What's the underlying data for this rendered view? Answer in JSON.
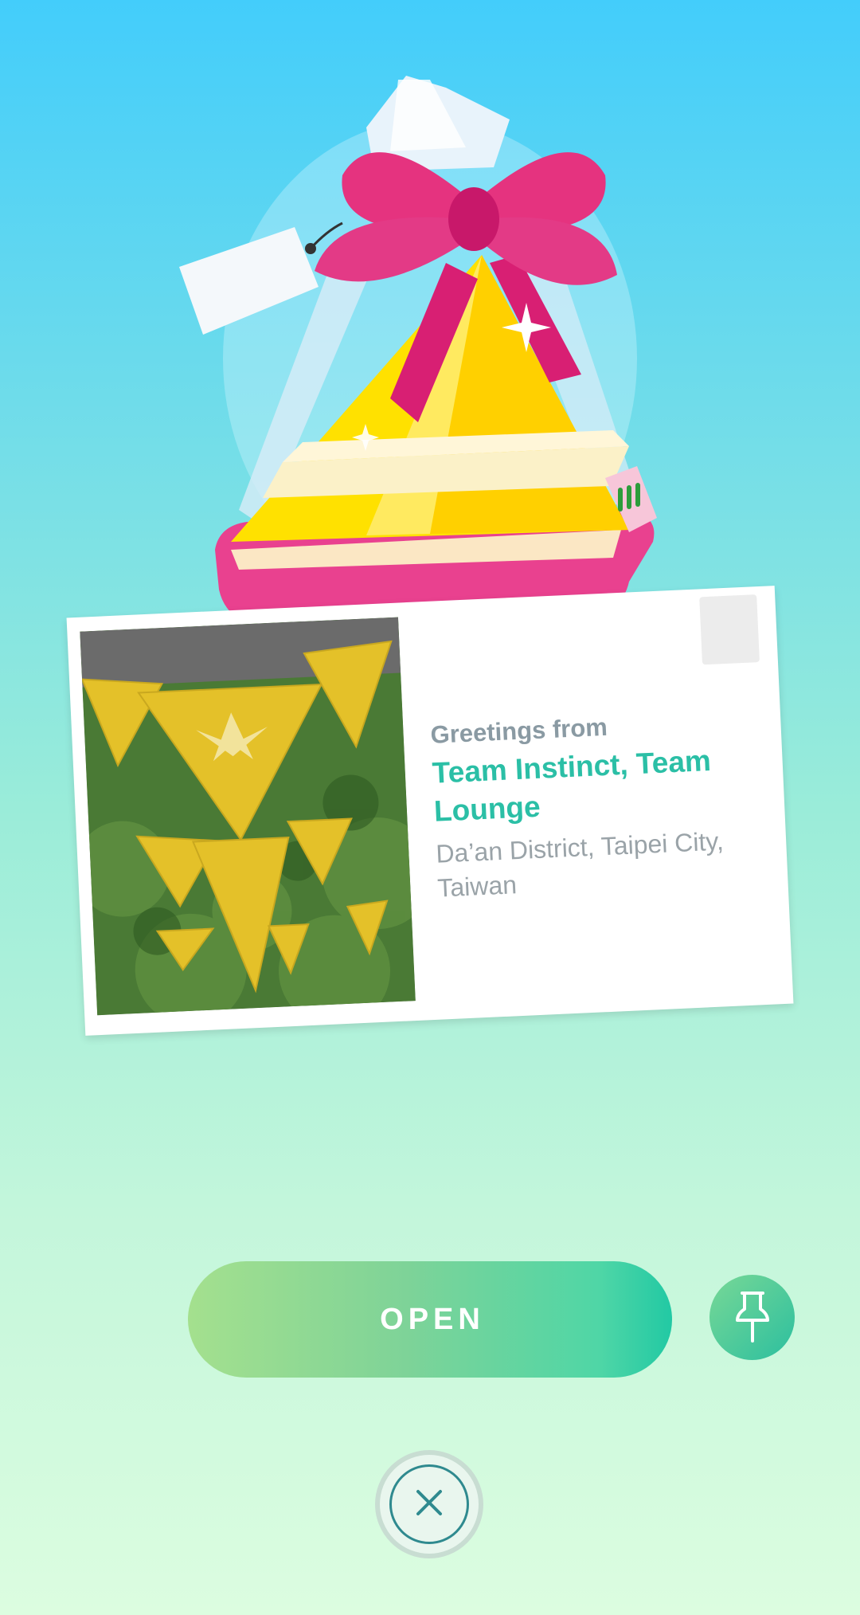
{
  "gift": {
    "image_name": "gift-icon"
  },
  "postcard": {
    "greeting_label": "Greetings from",
    "location_name": "Team Instinct, Team Lounge",
    "address": "Da’an District, Taipei City, Taiwan",
    "photo_name": "team-instinct-banners-photo"
  },
  "actions": {
    "open_label": "OPEN",
    "pin_icon": "pin-icon",
    "close_icon": "close-icon"
  },
  "colors": {
    "accent_teal": "#2bbfa6",
    "button_start": "#a4e08e",
    "button_end": "#22c9a4",
    "gift_yellow": "#ffe100",
    "bow_pink": "#e5337f"
  }
}
